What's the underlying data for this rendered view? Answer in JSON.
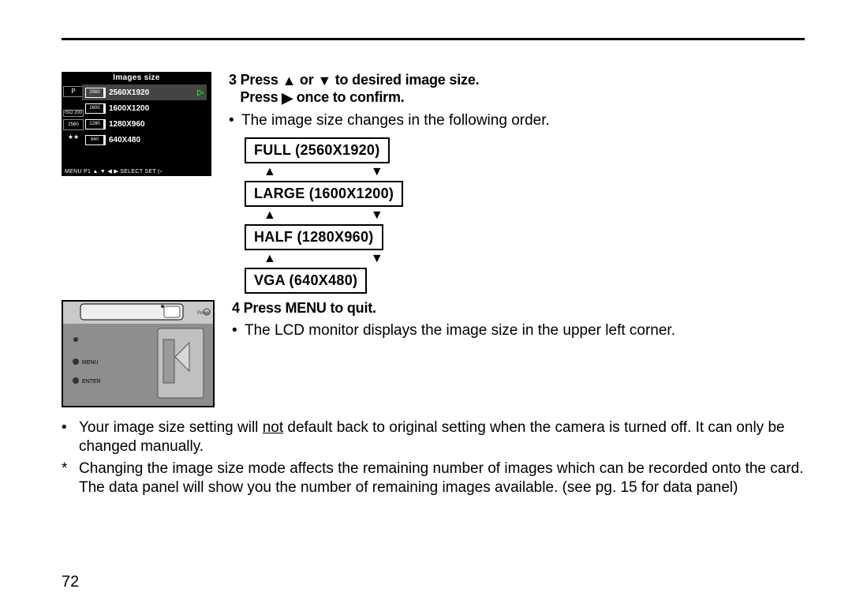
{
  "lcd": {
    "title": "Images size",
    "left_labels": [
      "P",
      "",
      "ISO 200",
      "2560",
      "★★"
    ],
    "items": [
      {
        "box": "2560",
        "label": "2560X1920",
        "selected": true
      },
      {
        "box": "1600",
        "label": "1600X1200",
        "selected": false
      },
      {
        "box": "1280",
        "label": "1280X960",
        "selected": false
      },
      {
        "box": "640",
        "label": "640X480",
        "selected": false
      }
    ],
    "footer": "MENU P1   ▲ ▼ ◀ ▶ SELECT   SET ▷"
  },
  "step3": {
    "num": "3",
    "line1a": "Press  ",
    "line1b": "  or  ",
    "line1c": "  to desired image size.",
    "line2a": "Press ",
    "line2b": " once to confirm."
  },
  "order_text": "The image size changes in the following order.",
  "ladder": [
    "FULL (2560X1920)",
    "LARGE (1600X1200)",
    "HALF (1280X960)",
    "VGA (640X480)"
  ],
  "step4": {
    "num": "4",
    "text": "Press MENU to quit."
  },
  "lcd_note": "The LCD monitor displays the image size in the upper left corner.",
  "thumb_labels": {
    "power": "Power",
    "menu": "MENU",
    "enter": "ENTER"
  },
  "notes": [
    {
      "mk": "•",
      "text_a": "Your image size setting will ",
      "under": "not",
      "text_b": " default back to original setting when the camera is turned off. It can only be changed manually."
    },
    {
      "mk": "*",
      "text": "Changing the image size mode affects the remaining number of images which can be recorded onto the card. The data panel will show you the number of remaining images available. (see pg. 15 for data panel)"
    }
  ],
  "page_number": "72"
}
